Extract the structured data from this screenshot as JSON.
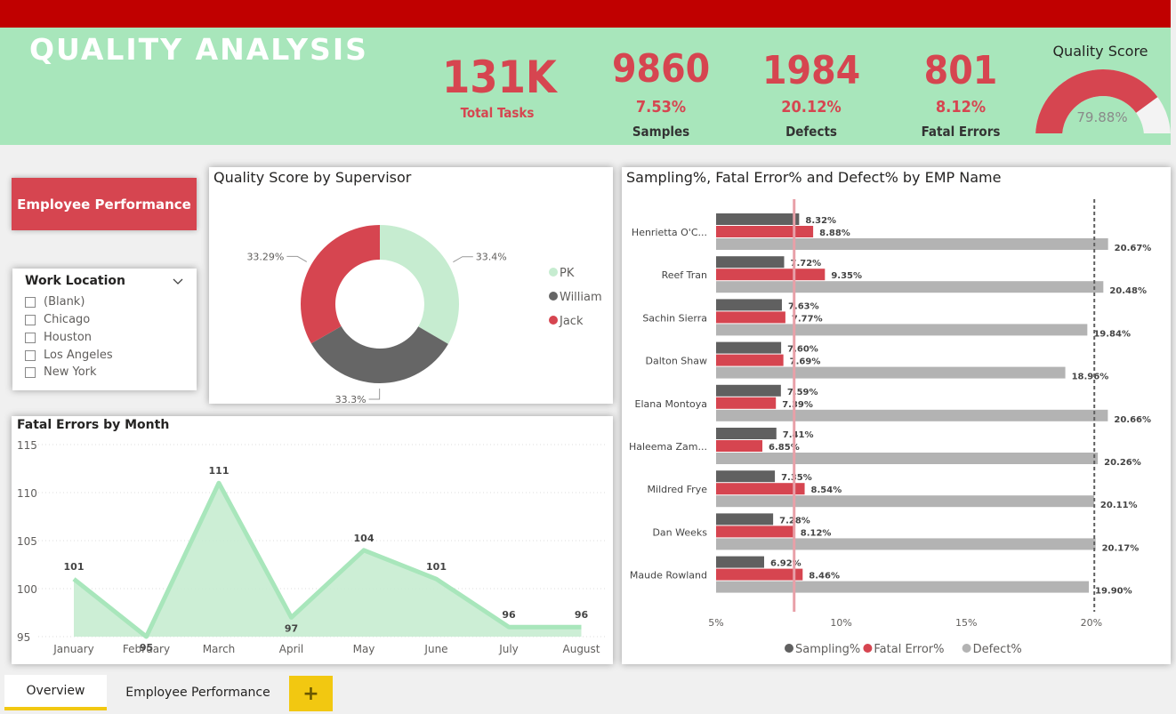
{
  "header": {
    "title": "QUALITY ANALYSIS",
    "kpis": [
      {
        "value": "131K",
        "pct": "",
        "label": "Total Tasks"
      },
      {
        "value": "9860",
        "pct": "7.53%",
        "label": "Samples"
      },
      {
        "value": "1984",
        "pct": "20.12%",
        "label": "Defects"
      },
      {
        "value": "801",
        "pct": "8.12%",
        "label": "Fatal Errors"
      }
    ],
    "gauge": {
      "title": "Quality Score",
      "value_label": "79.88%",
      "value": 79.88,
      "fill_color": "#d64550",
      "track_color": "#f3f3f3"
    }
  },
  "employee_button": {
    "label": "Employee Performance"
  },
  "slicer": {
    "title": "Work Location",
    "items": [
      "(Blank)",
      "Chicago",
      "Houston",
      "Los Angeles",
      "New York"
    ]
  },
  "colors": {
    "accent": "#d64550",
    "green": "#a8e6bb",
    "dark": "#606060",
    "grey": "#b3b3b3",
    "light_green": "#c6ecd0"
  },
  "chart_data": [
    {
      "type": "pie",
      "title": "Quality Score by Supervisor",
      "labels": [
        "PK",
        "William",
        "Jack"
      ],
      "values": [
        33.4,
        33.3,
        33.29
      ],
      "value_labels": [
        "33.4%",
        "33.3%",
        "33.29%"
      ],
      "colors": [
        "#c6ecd0",
        "#666666",
        "#d64550"
      ],
      "legend": "right"
    },
    {
      "type": "area",
      "title": "Fatal Errors by Month",
      "categories": [
        "January",
        "February",
        "March",
        "April",
        "May",
        "June",
        "July",
        "August"
      ],
      "values": [
        101,
        95,
        111,
        97,
        104,
        101,
        96,
        96
      ],
      "yticks": [
        95,
        100,
        105,
        110,
        115
      ],
      "ylim": [
        95,
        115
      ],
      "grid": true
    },
    {
      "type": "bar",
      "orientation": "horizontal",
      "title": "Sampling%, Fatal Error% and Defect% by EMP Name",
      "categories": [
        "Henrietta O'C...",
        "Reef Tran",
        "Sachin Sierra",
        "Dalton Shaw",
        "Elana Montoya",
        "Haleema Zam...",
        "Mildred Frye",
        "Dan Weeks",
        "Maude Rowland"
      ],
      "series": [
        {
          "name": "Sampling%",
          "color": "#606060",
          "values": [
            8.32,
            7.72,
            7.63,
            7.6,
            7.59,
            7.41,
            7.35,
            7.28,
            6.92
          ]
        },
        {
          "name": "Fatal Error%",
          "color": "#d64550",
          "values": [
            8.88,
            9.35,
            7.77,
            7.69,
            7.39,
            6.85,
            8.54,
            8.12,
            8.46
          ]
        },
        {
          "name": "Defect%",
          "color": "#b3b3b3",
          "values": [
            20.67,
            20.48,
            19.84,
            18.96,
            20.66,
            20.26,
            20.11,
            20.17,
            19.9
          ]
        }
      ],
      "value_labels": [
        [
          "8.32%",
          "7.72%",
          "7.63%",
          "7.60%",
          "7.59%",
          "7.41%",
          "7.35%",
          "7.28%",
          "6.92%"
        ],
        [
          "8.88%",
          "9.35%",
          "7.77%",
          "7.69%",
          "7.39%",
          "6.85%",
          "8.54%",
          "8.12%",
          "8.46%"
        ],
        [
          "20.67%",
          "20.48%",
          "19.84%",
          "18.96%",
          "20.66%",
          "20.26%",
          "20.11%",
          "20.17%",
          "19.90%"
        ]
      ],
      "xticks": [
        "5%",
        "10%",
        "15%",
        "20%"
      ],
      "xtick_values": [
        5,
        10,
        15,
        20
      ],
      "xlim": [
        5,
        21.5
      ],
      "reference_lines": [
        {
          "value": 8.12,
          "style": "solid",
          "color": "#e8a0a8"
        },
        {
          "value": 20.12,
          "style": "dashed",
          "color": "#606060"
        }
      ],
      "legend": "bottom"
    }
  ],
  "tabs": {
    "items": [
      "Overview",
      "Employee Performance"
    ],
    "active": 0,
    "add_label": "+"
  }
}
